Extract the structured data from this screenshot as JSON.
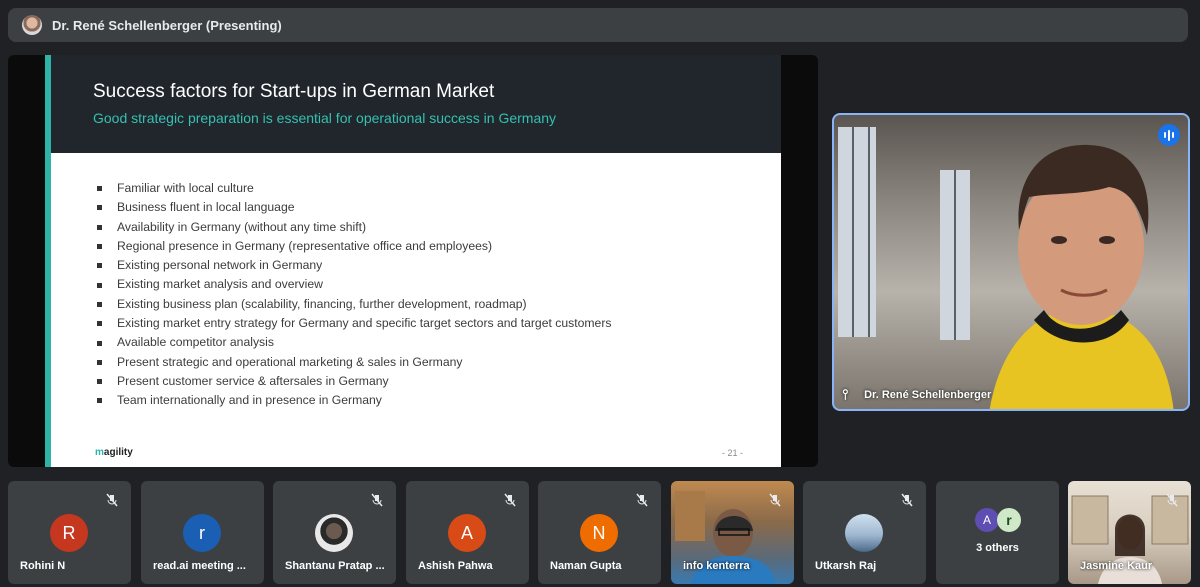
{
  "presenter_bar": {
    "title": "Dr. René Schellenberger (Presenting)"
  },
  "slide": {
    "title": "Success factors for Start-ups in German Market",
    "subtitle": "Good strategic preparation is essential for operational success in Germany",
    "bullets": [
      "Familiar with local culture",
      "Business fluent in local language",
      "Availability in Germany (without any time shift)",
      "Regional presence in Germany (representative office and employees)",
      "Existing personal network in Germany",
      "Existing market analysis and overview",
      "Existing business plan (scalability, financing, further development, roadmap)",
      "Existing market entry strategy for Germany and specific target sectors and target customers",
      "Available competitor analysis",
      "Present strategic and operational marketing & sales in Germany",
      "Present customer service & aftersales in Germany",
      "Team internationally and in presence in Germany"
    ],
    "logo": "magility",
    "page_number": "- 21 -"
  },
  "speaker": {
    "name": "Dr. René Schellenberger"
  },
  "participants": [
    {
      "name": "Rohini N",
      "initial": "R",
      "color": "#c5381f"
    },
    {
      "name": "read.ai meeting ...",
      "initial": "r",
      "color": "#1a5fb4"
    },
    {
      "name": "Shantanu Pratap ...",
      "initial": "",
      "color": "#eeeeee"
    },
    {
      "name": "Ashish Pahwa",
      "initial": "A",
      "color": "#d84a16"
    },
    {
      "name": "Naman Gupta",
      "initial": "N",
      "color": "#ef6c00"
    },
    {
      "name": "info kenterra",
      "initial": "",
      "color": "#6a5a4a"
    },
    {
      "name": "Utkarsh Raj",
      "initial": "",
      "color": "#a8b8c8"
    },
    {
      "name": "3 others",
      "initial": "",
      "color": ""
    },
    {
      "name": "Jasmine Kaur",
      "initial": "",
      "color": "#b8a898"
    }
  ],
  "others_avatars": {
    "a_initial": "A",
    "r_initial": "r",
    "a_color": "#5e4db2",
    "r_color": "#cfe8c8"
  },
  "icons": [
    "mic-off-icon",
    "speaking-indicator-icon",
    "pin-icon"
  ]
}
